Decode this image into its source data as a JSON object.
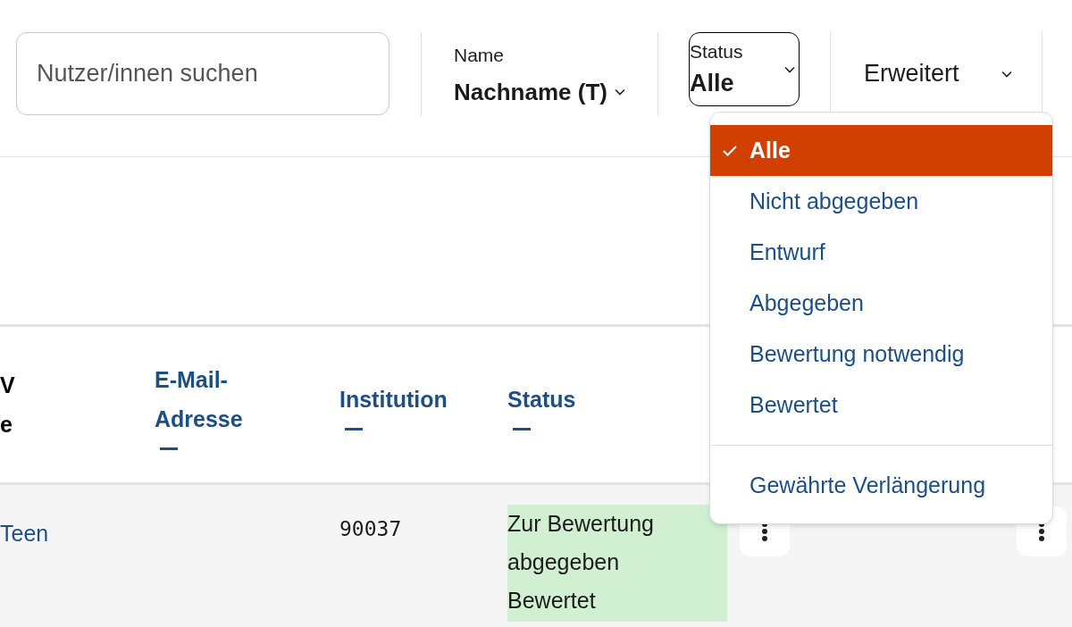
{
  "search": {
    "placeholder": "Nutzer/innen suchen"
  },
  "filters": {
    "name": {
      "label": "Name",
      "value": "Nachname (T)"
    },
    "status": {
      "label": "Status",
      "value": "Alle",
      "expanded": true
    },
    "advanced": {
      "label": "Erweitert"
    }
  },
  "status_menu": {
    "options": [
      {
        "label": "Alle",
        "selected": true
      },
      {
        "label": "Nicht abgegeben",
        "selected": false
      },
      {
        "label": "Entwurf",
        "selected": false
      },
      {
        "label": "Abgegeben",
        "selected": false
      },
      {
        "label": "Bewertung notwendig",
        "selected": false
      },
      {
        "label": "Bewertet",
        "selected": false
      }
    ],
    "extra_options": [
      {
        "label": "Gewährte Verlängerung",
        "selected": false
      }
    ]
  },
  "table": {
    "columns": [
      {
        "lines": [
          "V",
          "e"
        ],
        "sort": false
      },
      {
        "lines": [
          "E-Mail-",
          "Adresse"
        ],
        "sort": true
      },
      {
        "lines": [
          "Institution"
        ],
        "sort": true
      },
      {
        "lines": [
          "Status"
        ],
        "sort": true
      }
    ],
    "rows": [
      {
        "column_1": "Teen",
        "institution": "90037",
        "status": [
          "Zur Bewertung abgegeben",
          "Bewertet"
        ],
        "color": "#d1f0d1"
      }
    ]
  }
}
